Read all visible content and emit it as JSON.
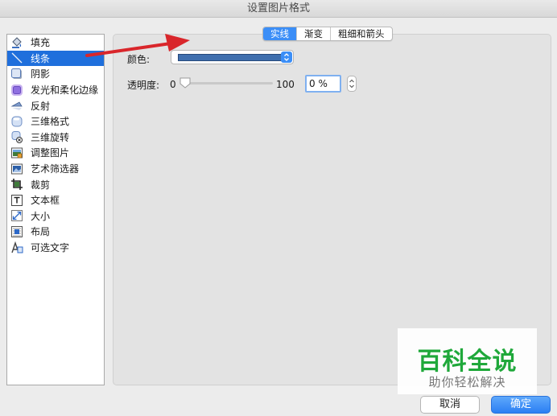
{
  "window": {
    "title": "设置图片格式"
  },
  "sidebar": {
    "items": [
      {
        "label": "填充",
        "icon": "fill-bucket-icon"
      },
      {
        "label": "线条",
        "icon": "line-icon",
        "selected": true
      },
      {
        "label": "阴影",
        "icon": "shadow-icon"
      },
      {
        "label": "发光和柔化边缘",
        "icon": "glow-icon"
      },
      {
        "label": "反射",
        "icon": "reflection-icon"
      },
      {
        "label": "三维格式",
        "icon": "3d-format-icon"
      },
      {
        "label": "三维旋转",
        "icon": "3d-rotation-icon"
      },
      {
        "label": "调整图片",
        "icon": "adjust-picture-icon"
      },
      {
        "label": "艺术筛选器",
        "icon": "artistic-filter-icon"
      },
      {
        "label": "裁剪",
        "icon": "crop-icon"
      },
      {
        "label": "文本框",
        "icon": "text-box-icon"
      },
      {
        "label": "大小",
        "icon": "size-icon"
      },
      {
        "label": "布局",
        "icon": "layout-icon"
      },
      {
        "label": "可选文字",
        "icon": "alt-text-icon"
      }
    ]
  },
  "tabs": [
    {
      "label": "实线",
      "active": true
    },
    {
      "label": "渐变"
    },
    {
      "label": "粗细和箭头"
    }
  ],
  "line": {
    "color_label": "颜色:",
    "color_value": "#3f6fae",
    "transparency_label": "透明度:",
    "slider_min": "0",
    "slider_max": "100",
    "transparency_value": "0 %",
    "transparency_fraction": 0
  },
  "buttons": {
    "cancel": "取消",
    "ok": "确定"
  },
  "watermark": {
    "title": "百科全说",
    "subtitle": "助你轻松解决"
  },
  "colors": {
    "accent": "#3b8ef7",
    "selection": "#1f6fdc",
    "annotation_arrow": "#d9262b",
    "watermark_green": "#1fa83a"
  }
}
